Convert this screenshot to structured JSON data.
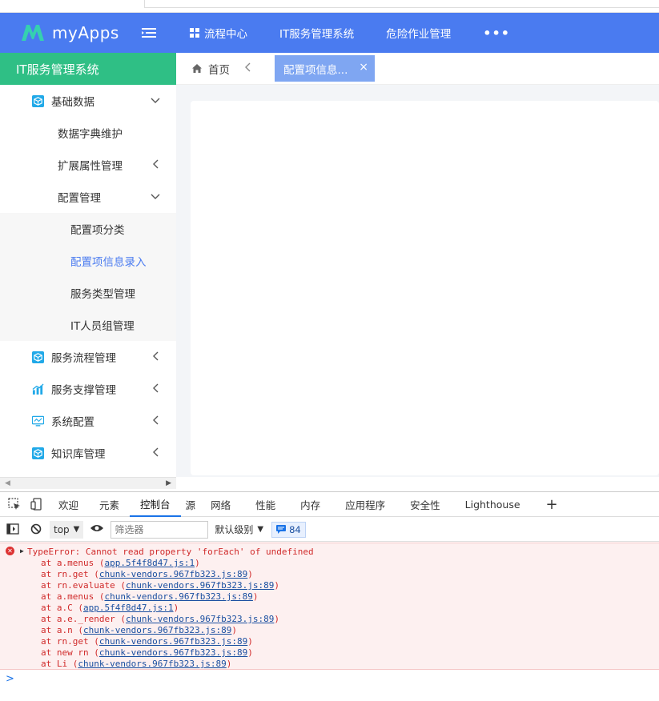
{
  "header": {
    "app_name": "myApps",
    "nav": [
      {
        "label": "流程中心"
      },
      {
        "label": "IT服务管理系统"
      },
      {
        "label": "危险作业管理"
      }
    ],
    "more": "•••",
    "color": "#4a7bf0"
  },
  "sidebar": {
    "title": "IT服务管理系统",
    "items": [
      {
        "label": "基础数据",
        "icon": "cube-icon"
      },
      {
        "label": "数据字典维护"
      },
      {
        "label": "扩展属性管理"
      },
      {
        "label": "配置管理"
      },
      {
        "label": "配置项分类"
      },
      {
        "label": "配置项信息录入"
      },
      {
        "label": "服务类型管理"
      },
      {
        "label": "IT人员组管理"
      },
      {
        "label": "服务流程管理",
        "icon": "cube-icon"
      },
      {
        "label": "服务支撑管理",
        "icon": "chart-icon"
      },
      {
        "label": "系统配置",
        "icon": "monitor-icon"
      },
      {
        "label": "知识库管理",
        "icon": "cube-icon"
      }
    ]
  },
  "tabs": {
    "home": "首页",
    "active": "配置项信息...",
    "close": "×"
  },
  "devtools": {
    "tabs": [
      "欢迎",
      "元素",
      "控制台",
      "源",
      "网络",
      "性能",
      "内存",
      "应用程序",
      "安全性",
      "Lighthouse"
    ],
    "active_tab": "控制台",
    "context": "top",
    "filter_placeholder": "筛选器",
    "level": "默认级别",
    "message_count": "84"
  },
  "console": {
    "error": "TypeError: Cannot read property 'forEach' of undefined",
    "stack": [
      {
        "prefix": "at a.menus (",
        "link": "app.5f4f8d47.js:1",
        "suffix": ")"
      },
      {
        "prefix": "at rn.get (",
        "link": "chunk-vendors.967fb323.js:89",
        "suffix": ")"
      },
      {
        "prefix": "at rn.evaluate (",
        "link": "chunk-vendors.967fb323.js:89",
        "suffix": ")"
      },
      {
        "prefix": "at a.menus (",
        "link": "chunk-vendors.967fb323.js:89",
        "suffix": ")"
      },
      {
        "prefix": "at a.C (",
        "link": "app.5f4f8d47.js:1",
        "suffix": ")"
      },
      {
        "prefix": "at a.e._render (",
        "link": "chunk-vendors.967fb323.js:89",
        "suffix": ")"
      },
      {
        "prefix": "at a.n (",
        "link": "chunk-vendors.967fb323.js:89",
        "suffix": ")"
      },
      {
        "prefix": "at rn.get (",
        "link": "chunk-vendors.967fb323.js:89",
        "suffix": ")"
      },
      {
        "prefix": "at new rn (",
        "link": "chunk-vendors.967fb323.js:89",
        "suffix": ")"
      },
      {
        "prefix": "at Li (",
        "link": "chunk-vendors.967fb323.js:89",
        "suffix": ")"
      }
    ],
    "prompt": ">"
  }
}
